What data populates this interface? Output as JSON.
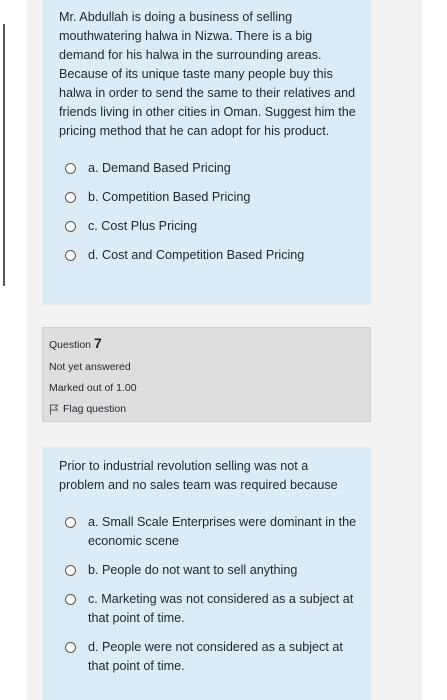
{
  "question6": {
    "text": "Mr. Abdullah is doing a business of selling mouthwatering halwa in Nizwa. There is a big demand for his halwa in the surrounding areas. Because of its unique taste many people buy this halwa in order to send the same to their relatives and friends living in other cities in Oman. Suggest him the pricing method that he can adopt for his product.",
    "answers": [
      "a. Demand Based Pricing",
      "b. Competition Based Pricing",
      "c. Cost Plus Pricing",
      "d. Cost and Competition Based Pricing"
    ]
  },
  "question7_info": {
    "label": "Question",
    "number": "7",
    "status": "Not yet answered",
    "marked": "Marked out of 1.00",
    "flag": "Flag question"
  },
  "question7": {
    "text": "Prior to industrial revolution selling was not a problem and no sales team was required because",
    "answers": [
      "a. Small Scale Enterprises were dominant in the economic scene",
      "b. People do not want to sell anything",
      "c. Marketing was not considered as a subject at that point of time.",
      "d. People were not considered as a subject at that point of time."
    ]
  },
  "icons": {
    "radio": "radio-button-icon",
    "flag": "flag-icon"
  }
}
